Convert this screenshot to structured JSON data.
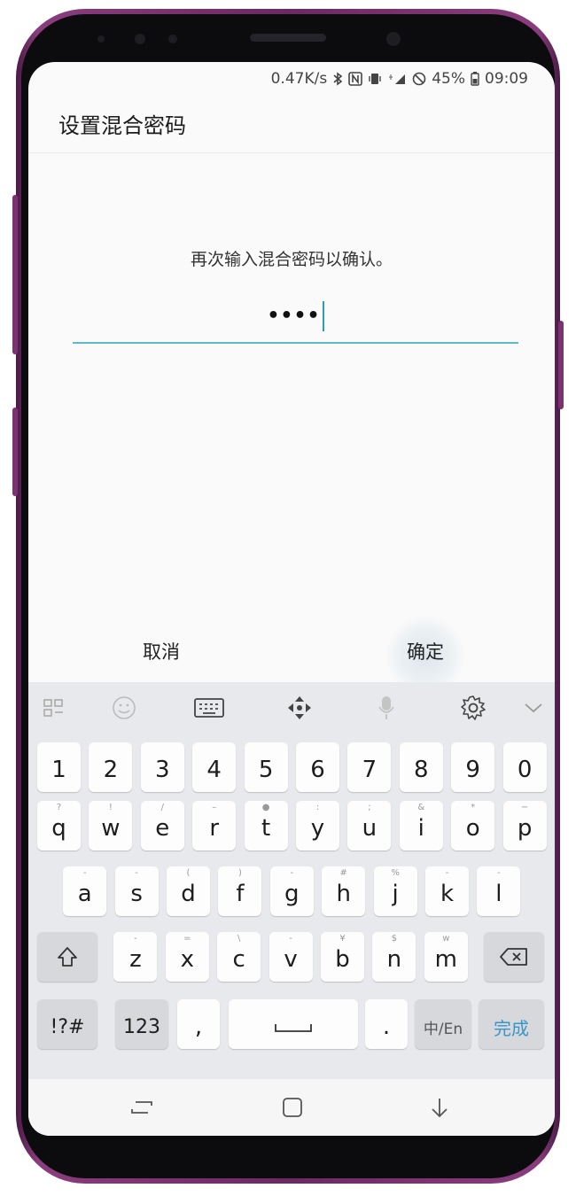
{
  "status_bar": {
    "net_speed": "0.47K/s",
    "battery": "45%",
    "time": "09:09"
  },
  "app_bar": {
    "title": "设置混合密码"
  },
  "dialog": {
    "prompt": "再次输入混合密码以确认。",
    "password_masked": "••••",
    "cancel_label": "取消",
    "ok_label": "确定"
  },
  "keyboard": {
    "toolbar_icons": [
      "grid-icon",
      "emoji-icon",
      "keyboard-icon",
      "move-icon",
      "mic-icon",
      "gear-icon",
      "chevron-down-icon"
    ],
    "row_numbers": [
      "1",
      "2",
      "3",
      "4",
      "5",
      "6",
      "7",
      "8",
      "9",
      "0"
    ],
    "row_qwerty": [
      {
        "k": "q",
        "h": "?"
      },
      {
        "k": "w",
        "h": "!"
      },
      {
        "k": "e",
        "h": "/"
      },
      {
        "k": "r",
        "h": "–"
      },
      {
        "k": "t",
        "h": "●"
      },
      {
        "k": "y",
        "h": ":"
      },
      {
        "k": "u",
        "h": ";"
      },
      {
        "k": "i",
        "h": "&"
      },
      {
        "k": "o",
        "h": "*"
      },
      {
        "k": "p",
        "h": "−"
      }
    ],
    "row_asdf": [
      {
        "k": "a",
        "h": "-"
      },
      {
        "k": "s",
        "h": "-"
      },
      {
        "k": "d",
        "h": "("
      },
      {
        "k": "f",
        "h": ")"
      },
      {
        "k": "g",
        "h": "-"
      },
      {
        "k": "h",
        "h": "#"
      },
      {
        "k": "j",
        "h": "%"
      },
      {
        "k": "k",
        "h": "-"
      },
      {
        "k": "l",
        "h": "-"
      }
    ],
    "row_zxcv": [
      {
        "k": "z",
        "h": "-"
      },
      {
        "k": "x",
        "h": "="
      },
      {
        "k": "c",
        "h": "\\"
      },
      {
        "k": "v",
        "h": "-"
      },
      {
        "k": "b",
        "h": "¥"
      },
      {
        "k": "n",
        "h": "$"
      },
      {
        "k": "m",
        "h": "w"
      }
    ],
    "bottom": {
      "symbols": "!?#",
      "numbers": "123",
      "comma": ",",
      "space": "⎵",
      "period": ".",
      "lang": "中/En",
      "done": "完成"
    }
  },
  "colors": {
    "accent": "#5fb9c7",
    "done": "#3a95c9",
    "phone_frame": "#7a3370"
  }
}
